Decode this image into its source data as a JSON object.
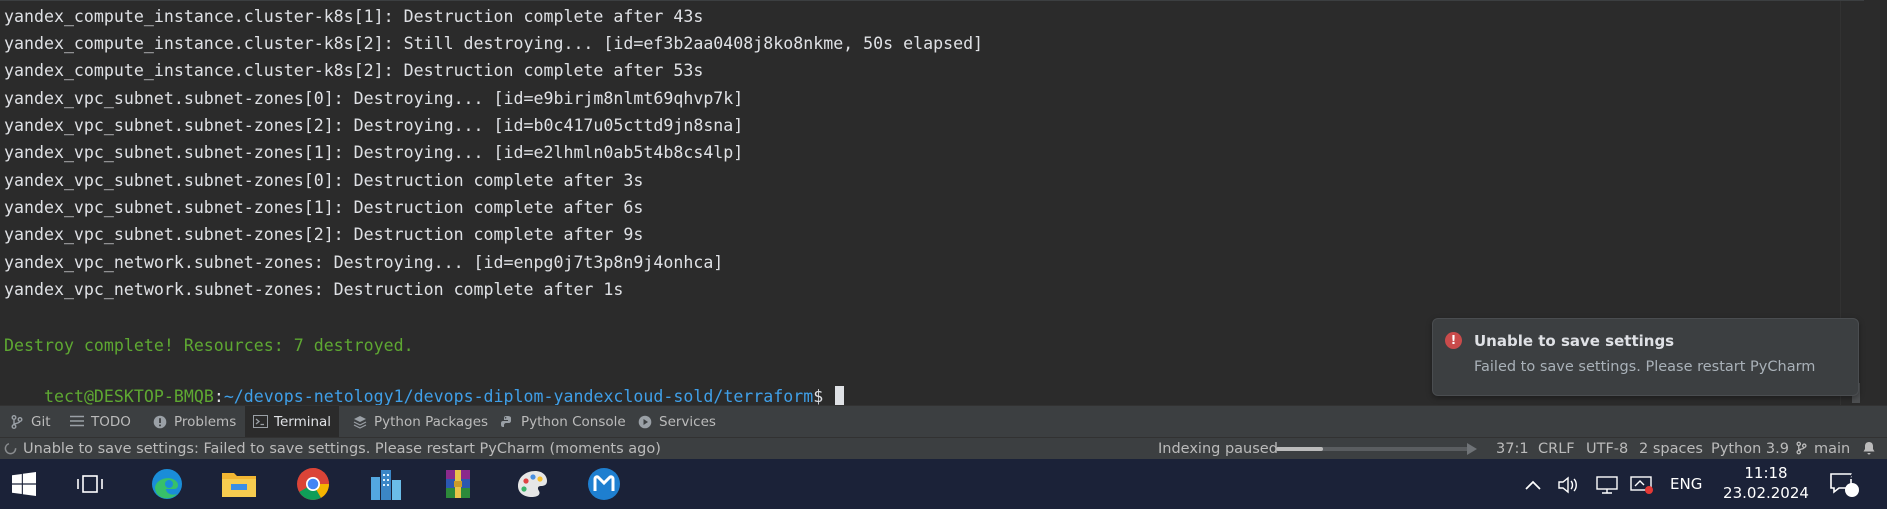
{
  "terminal": {
    "lines": [
      "yandex_compute_instance.cluster-k8s[1]: Destruction complete after 43s",
      "yandex_compute_instance.cluster-k8s[2]: Still destroying... [id=ef3b2aa0408j8ko8nkme, 50s elapsed]",
      "yandex_compute_instance.cluster-k8s[2]: Destruction complete after 53s",
      "yandex_vpc_subnet.subnet-zones[0]: Destroying... [id=e9birjm8nlmt69qhvp7k]",
      "yandex_vpc_subnet.subnet-zones[2]: Destroying... [id=b0c417u05cttd9jn8sna]",
      "yandex_vpc_subnet.subnet-zones[1]: Destroying... [id=e2lhmln0ab5t4b8cs4lp]",
      "yandex_vpc_subnet.subnet-zones[0]: Destruction complete after 3s",
      "yandex_vpc_subnet.subnet-zones[1]: Destruction complete after 6s",
      "yandex_vpc_subnet.subnet-zones[2]: Destruction complete after 9s",
      "yandex_vpc_network.subnet-zones: Destroying... [id=enpg0j7t3p8n9j4onhca]",
      "yandex_vpc_network.subnet-zones: Destruction complete after 1s"
    ],
    "success": "Destroy complete! Resources: 7 destroyed.",
    "prompt_user": "tect",
    "prompt_host": "@DESKTOP-BMQB",
    "prompt_colon": ":",
    "prompt_path": "~/devops-netology1/devops-diplom-yandexcloud-sold/terraform",
    "prompt_symbol": "$"
  },
  "notification": {
    "icon": "error-icon",
    "icon_glyph": "!",
    "title": "Unable to save settings",
    "body": "Failed to save settings. Please restart PyCharm"
  },
  "toolwindows": {
    "git": "Git",
    "todo": "TODO",
    "problems": "Problems",
    "terminal": "Terminal",
    "python_packages": "Python Packages",
    "python_console": "Python Console",
    "services": "Services"
  },
  "status": {
    "message": "Unable to save settings: Failed to save settings. Please restart PyCharm (moments ago)",
    "indexing": "Indexing paused",
    "indexing_progress": 0.24,
    "position": "37:1",
    "line_sep": "CRLF",
    "encoding": "UTF-8",
    "indent": "2 spaces",
    "interpreter": "Python 3.9",
    "branch": "main"
  },
  "taskbar": {
    "language": "ENG",
    "time": "11:18",
    "date": "23.02.2024",
    "notifications_count": "2",
    "apps": [
      "start",
      "task-view",
      "edge",
      "file-explorer",
      "chrome",
      "city-app",
      "winrar",
      "paint",
      "meta-app"
    ]
  },
  "colors": {
    "terminal_bg": "#2b2b2b",
    "success": "#5ea832",
    "path": "#3f9fe8",
    "error": "#c94b4b",
    "taskbar": "#1b2238"
  }
}
